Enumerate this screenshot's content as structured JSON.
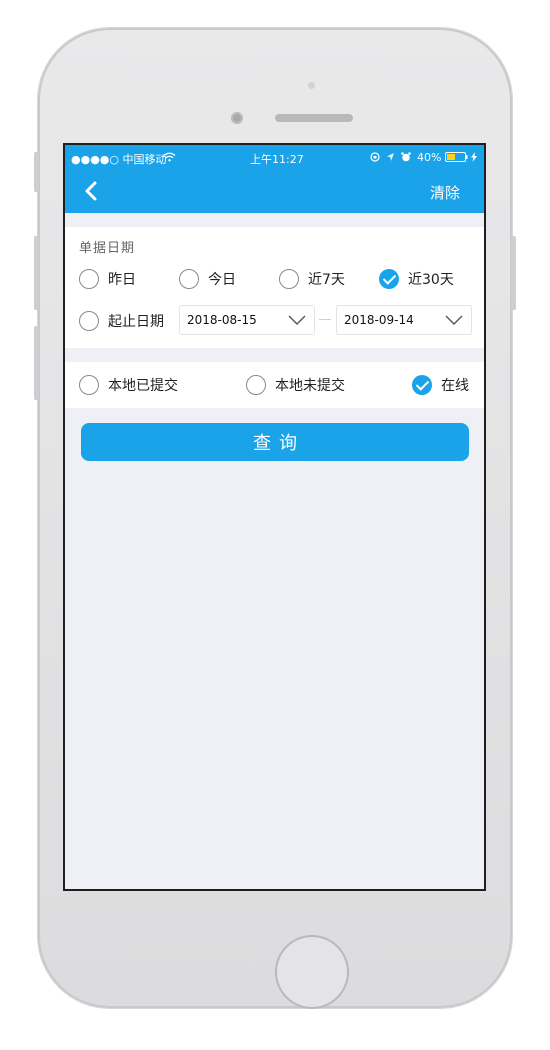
{
  "status_bar": {
    "carrier": "●●●●○ 中国移动",
    "time": "上午11:27",
    "battery": "40%"
  },
  "nav": {
    "back_icon": "chevron-left-icon",
    "clear_label": "清除"
  },
  "date_section": {
    "title": "单据日期",
    "options": [
      {
        "label": "昨日",
        "checked": false
      },
      {
        "label": "今日",
        "checked": false
      },
      {
        "label": "近7天",
        "checked": false
      },
      {
        "label": "近30天",
        "checked": true
      }
    ],
    "range_option": {
      "label": "起止日期",
      "checked": false
    },
    "start_date": "2018-08-15",
    "end_date": "2018-09-14"
  },
  "source_section": {
    "options": [
      {
        "label": "本地已提交",
        "checked": false
      },
      {
        "label": "本地未提交",
        "checked": false
      },
      {
        "label": "在线",
        "checked": true
      }
    ]
  },
  "query_button": "查询",
  "colors": {
    "accent": "#1aa3e8",
    "background": "#eff0f5"
  }
}
